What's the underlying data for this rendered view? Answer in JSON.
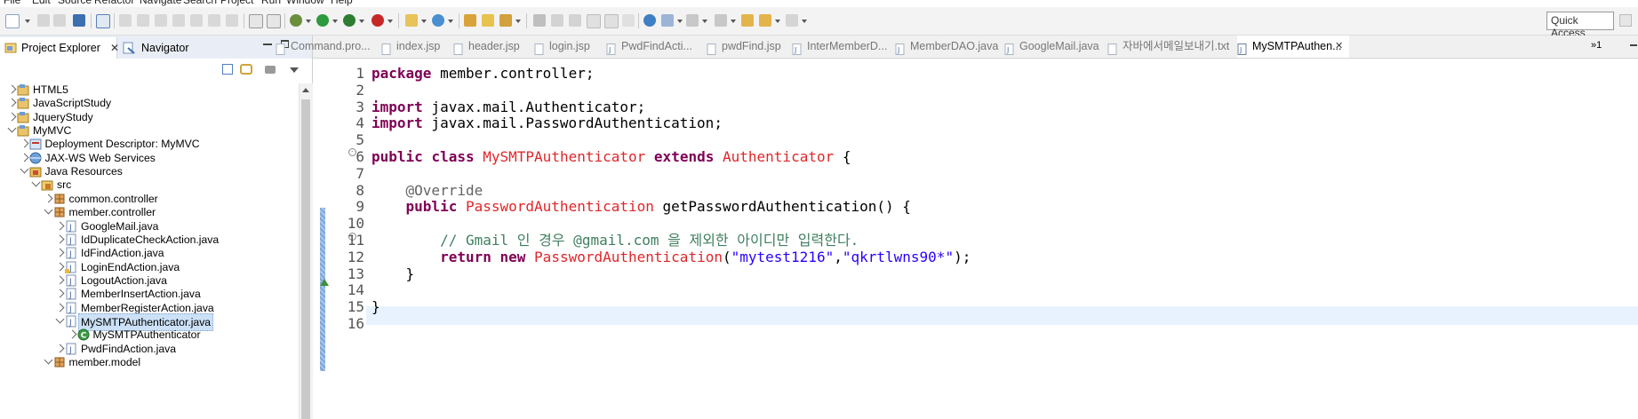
{
  "menubar": {
    "items": [
      "File",
      "Edit",
      "Source",
      "Refactor",
      "Navigate",
      "Search",
      "Project",
      "Run",
      "Window",
      "Help"
    ]
  },
  "toolbar": {
    "quick_access": "Quick Access"
  },
  "left_panel": {
    "tabs": [
      {
        "label": "Project Explorer",
        "icon": "package-explorer-icon"
      },
      {
        "label": "Navigator",
        "icon": "navigator-icon"
      }
    ],
    "tree": [
      {
        "label": "HTML5",
        "level": 0,
        "state": "closed",
        "icon": "project"
      },
      {
        "label": "JavaScriptStudy",
        "level": 0,
        "state": "closed",
        "icon": "project"
      },
      {
        "label": "JqueryStudy",
        "level": 0,
        "state": "closed",
        "icon": "project"
      },
      {
        "label": "MyMVC",
        "level": 0,
        "state": "open",
        "icon": "project"
      },
      {
        "label": "Deployment Descriptor: MyMVC",
        "level": 1,
        "state": "closed",
        "icon": "descriptor"
      },
      {
        "label": "JAX-WS Web Services",
        "level": 1,
        "state": "closed",
        "icon": "webservice"
      },
      {
        "label": "Java Resources",
        "level": 1,
        "state": "open",
        "icon": "resources"
      },
      {
        "label": "src",
        "level": 2,
        "state": "open",
        "icon": "srcfolder"
      },
      {
        "label": "common.controller",
        "level": 3,
        "state": "closed",
        "icon": "package"
      },
      {
        "label": "member.controller",
        "level": 3,
        "state": "open",
        "icon": "package"
      },
      {
        "label": "GoogleMail.java",
        "level": 4,
        "state": "closed",
        "icon": "javafile"
      },
      {
        "label": "IdDuplicateCheckAction.java",
        "level": 4,
        "state": "closed",
        "icon": "javafile"
      },
      {
        "label": "IdFindAction.java",
        "level": 4,
        "state": "closed",
        "icon": "javafile"
      },
      {
        "label": "LoginEndAction.java",
        "level": 4,
        "state": "closed",
        "icon": "javafile-warn"
      },
      {
        "label": "LogoutAction.java",
        "level": 4,
        "state": "closed",
        "icon": "javafile"
      },
      {
        "label": "MemberInsertAction.java",
        "level": 4,
        "state": "closed",
        "icon": "javafile"
      },
      {
        "label": "MemberRegisterAction.java",
        "level": 4,
        "state": "closed",
        "icon": "javafile"
      },
      {
        "label": "MySMTPAuthenticator.java",
        "level": 4,
        "state": "open",
        "icon": "javafile",
        "selected": true
      },
      {
        "label": "MySMTPAuthenticator",
        "level": 5,
        "state": "closed",
        "icon": "class"
      },
      {
        "label": "PwdFindAction.java",
        "level": 4,
        "state": "closed",
        "icon": "javafile"
      },
      {
        "label": "member.model",
        "level": 3,
        "state": "open",
        "icon": "package"
      }
    ]
  },
  "editor": {
    "tabs": [
      {
        "label": "Command.pro...",
        "icon": "file"
      },
      {
        "label": "index.jsp",
        "icon": "file"
      },
      {
        "label": "header.jsp",
        "icon": "file"
      },
      {
        "label": "login.jsp",
        "icon": "file"
      },
      {
        "label": "PwdFindActi...",
        "icon": "javafile"
      },
      {
        "label": "pwdFind.jsp",
        "icon": "file"
      },
      {
        "label": "InterMemberD...",
        "icon": "javafile"
      },
      {
        "label": "MemberDAO.java",
        "icon": "javafile"
      },
      {
        "label": "GoogleMail.java",
        "icon": "javafile"
      },
      {
        "label": "자바에서메일보내기.txt",
        "icon": "file"
      },
      {
        "label": "MySMTPAuthen...",
        "icon": "javafile",
        "active": true
      }
    ],
    "overflow_label": "»1",
    "line_numbers": [
      "1",
      "2",
      "3",
      "4",
      "5",
      "6",
      "7",
      "8",
      "9",
      "10",
      "11",
      "12",
      "13",
      "14",
      "15",
      "16"
    ],
    "code": {
      "l1": [
        "package",
        " member.controller;"
      ],
      "l3": [
        "import",
        " javax.mail.Authenticator;"
      ],
      "l4": [
        "import",
        " javax.mail.PasswordAuthentication;"
      ],
      "l6": [
        "public",
        " ",
        "class",
        " ",
        "MySMTPAuthenticator",
        " ",
        "extends",
        " ",
        "Authenticator",
        " {"
      ],
      "l8": [
        "    @Override"
      ],
      "l9": [
        "    ",
        "public",
        " ",
        "PasswordAuthentication",
        " getPasswordAuthentication() {"
      ],
      "l11": [
        "        // Gmail 인 경우 @gmail.com 을 제외한 아이디만 입력한다."
      ],
      "l12": [
        "        ",
        "return",
        " ",
        "new",
        " ",
        "PasswordAuthentication",
        "(",
        "\"mytest1216\"",
        ",",
        "\"qkrtlwns90*\"",
        ");"
      ],
      "l13": [
        "    }"
      ],
      "l15": [
        "}"
      ]
    }
  }
}
